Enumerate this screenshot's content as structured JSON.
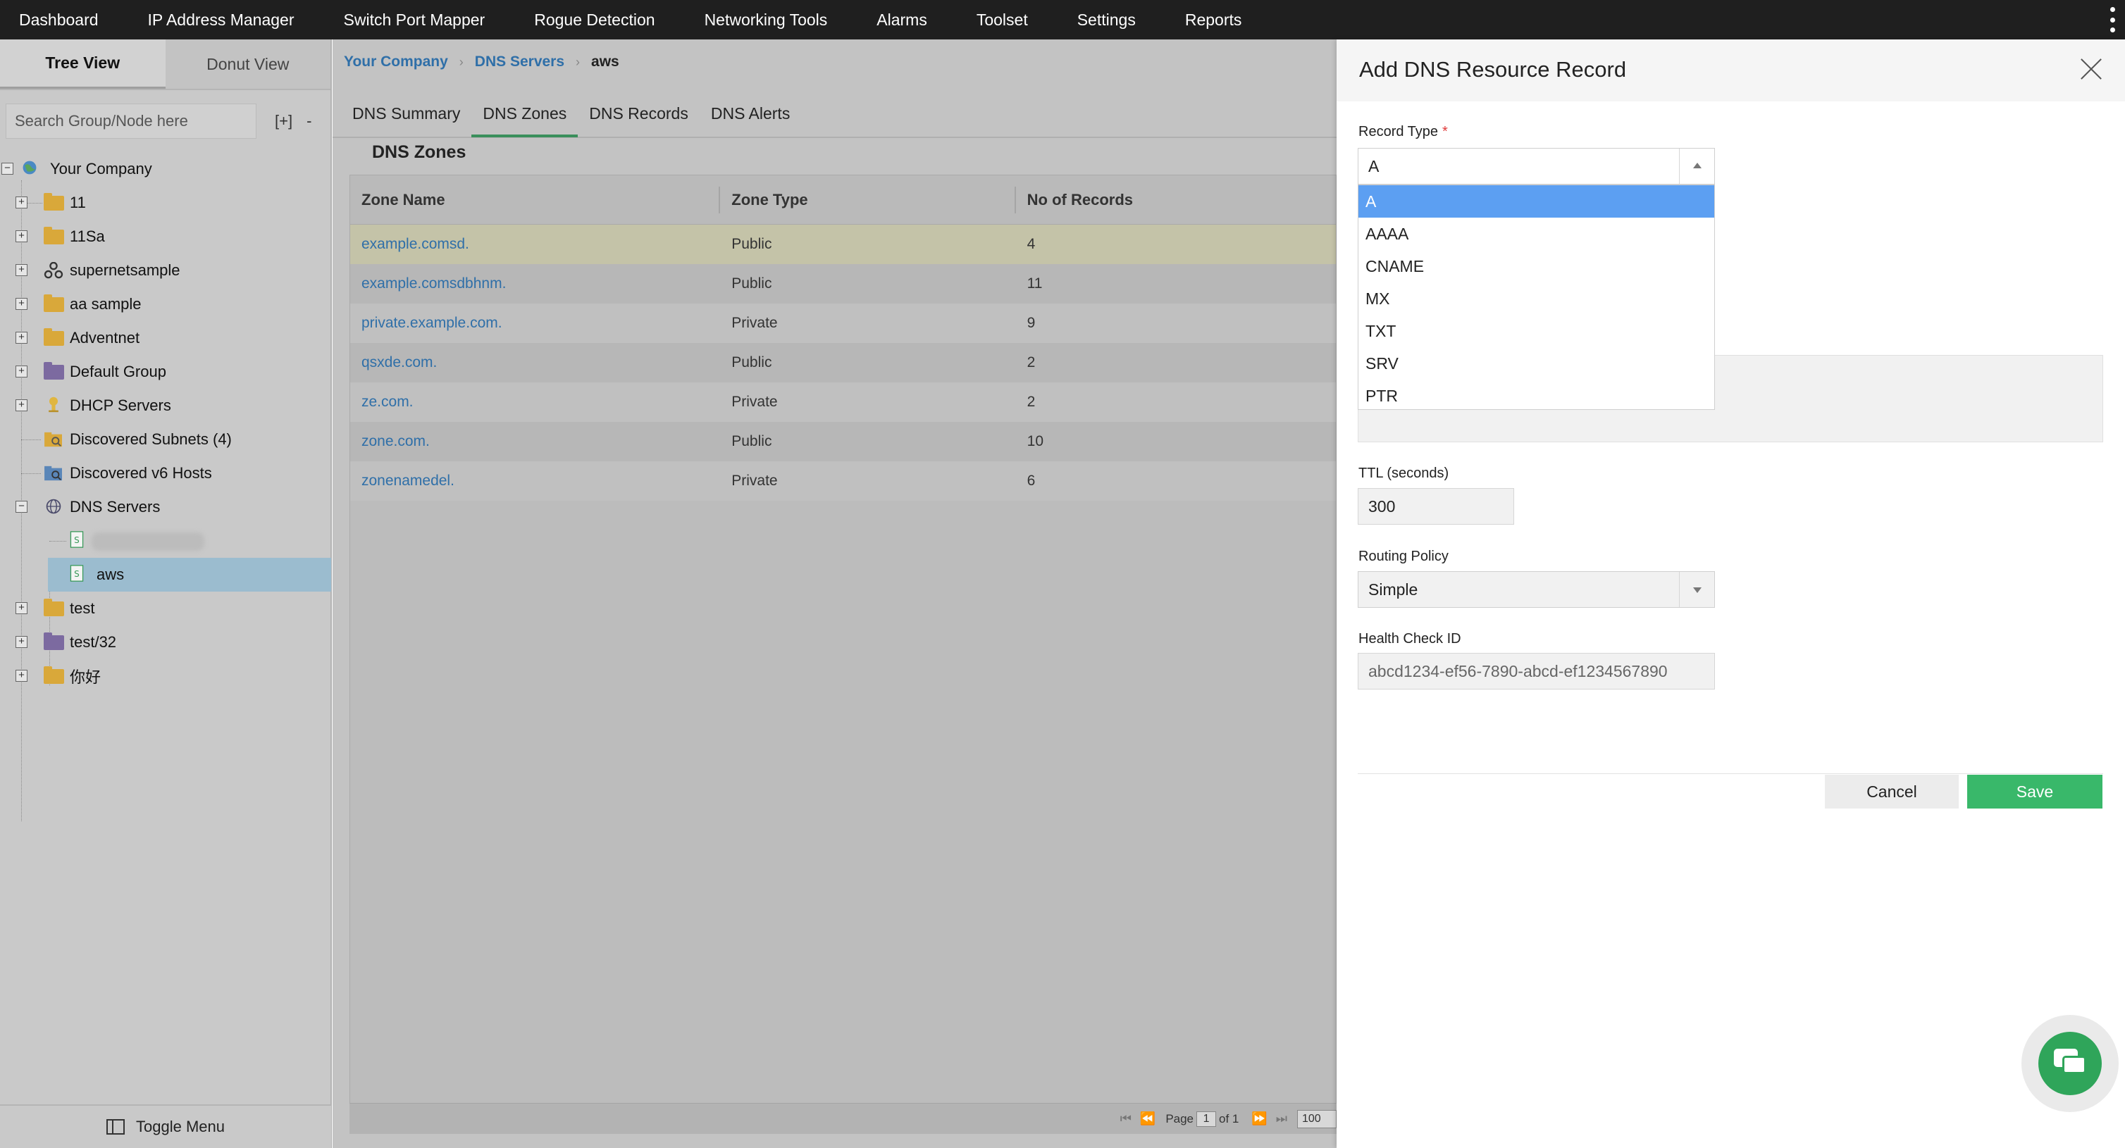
{
  "topnav": {
    "items": [
      "Dashboard",
      "IP Address Manager",
      "Switch Port Mapper",
      "Rogue Detection",
      "Networking Tools",
      "Alarms",
      "Toolset",
      "Settings",
      "Reports"
    ]
  },
  "sidebar": {
    "tabs": [
      "Tree View",
      "Donut View"
    ],
    "search_placeholder": "Search Group/Node here",
    "expand_all": "[+]",
    "collapse_all": "-",
    "tree": {
      "root": "Your Company",
      "items": [
        "11",
        "11Sa",
        "supernetsample",
        "aa sample",
        "Adventnet",
        "Default Group",
        "DHCP Servers",
        "Discovered Subnets (4)",
        "Discovered v6 Hosts",
        "DNS Servers",
        "aws",
        "test",
        "test/32",
        "你好"
      ]
    },
    "toggle_menu": "Toggle Menu"
  },
  "main": {
    "breadcrumb": [
      "Your Company",
      "DNS Servers",
      "aws"
    ],
    "subtabs": [
      "DNS Summary",
      "DNS Zones",
      "DNS Records",
      "DNS Alerts"
    ],
    "section_title": "DNS Zones",
    "table": {
      "headers": [
        "Zone Name",
        "Zone Type",
        "No of Records"
      ],
      "rows": [
        [
          "example.comsd.",
          "Public",
          "4"
        ],
        [
          "example.comsdbhnm.",
          "Public",
          "11"
        ],
        [
          "private.example.com.",
          "Private",
          "9"
        ],
        [
          "qsxde.com.",
          "Public",
          "2"
        ],
        [
          "ze.com.",
          "Private",
          "2"
        ],
        [
          "zone.com.",
          "Public",
          "10"
        ],
        [
          "zonenamedel.",
          "Private",
          "6"
        ]
      ]
    },
    "pager": {
      "page_label": "Page",
      "page": "1",
      "of_label": "of 1",
      "page_size": "100"
    }
  },
  "dialog": {
    "title": "Add DNS Resource Record",
    "record_type_label": "Record Type",
    "required_mark": "*",
    "record_type_value": "A",
    "record_type_options": [
      "A",
      "AAAA",
      "CNAME",
      "MX",
      "TXT",
      "SRV",
      "PTR"
    ],
    "ttl_label": "TTL (seconds)",
    "ttl_value": "300",
    "routing_label": "Routing Policy",
    "routing_value": "Simple",
    "health_label": "Health Check ID",
    "health_value": "abcd1234-ef56-7890-abcd-ef1234567890",
    "cancel": "Cancel",
    "save": "Save"
  },
  "colors": {
    "nav_bg": "#1f1f1f",
    "save_green": "#39b86a",
    "selected_option": "#5c9ff2",
    "link_blue": "#2f6fa8",
    "chat_green": "#2fa55a"
  }
}
